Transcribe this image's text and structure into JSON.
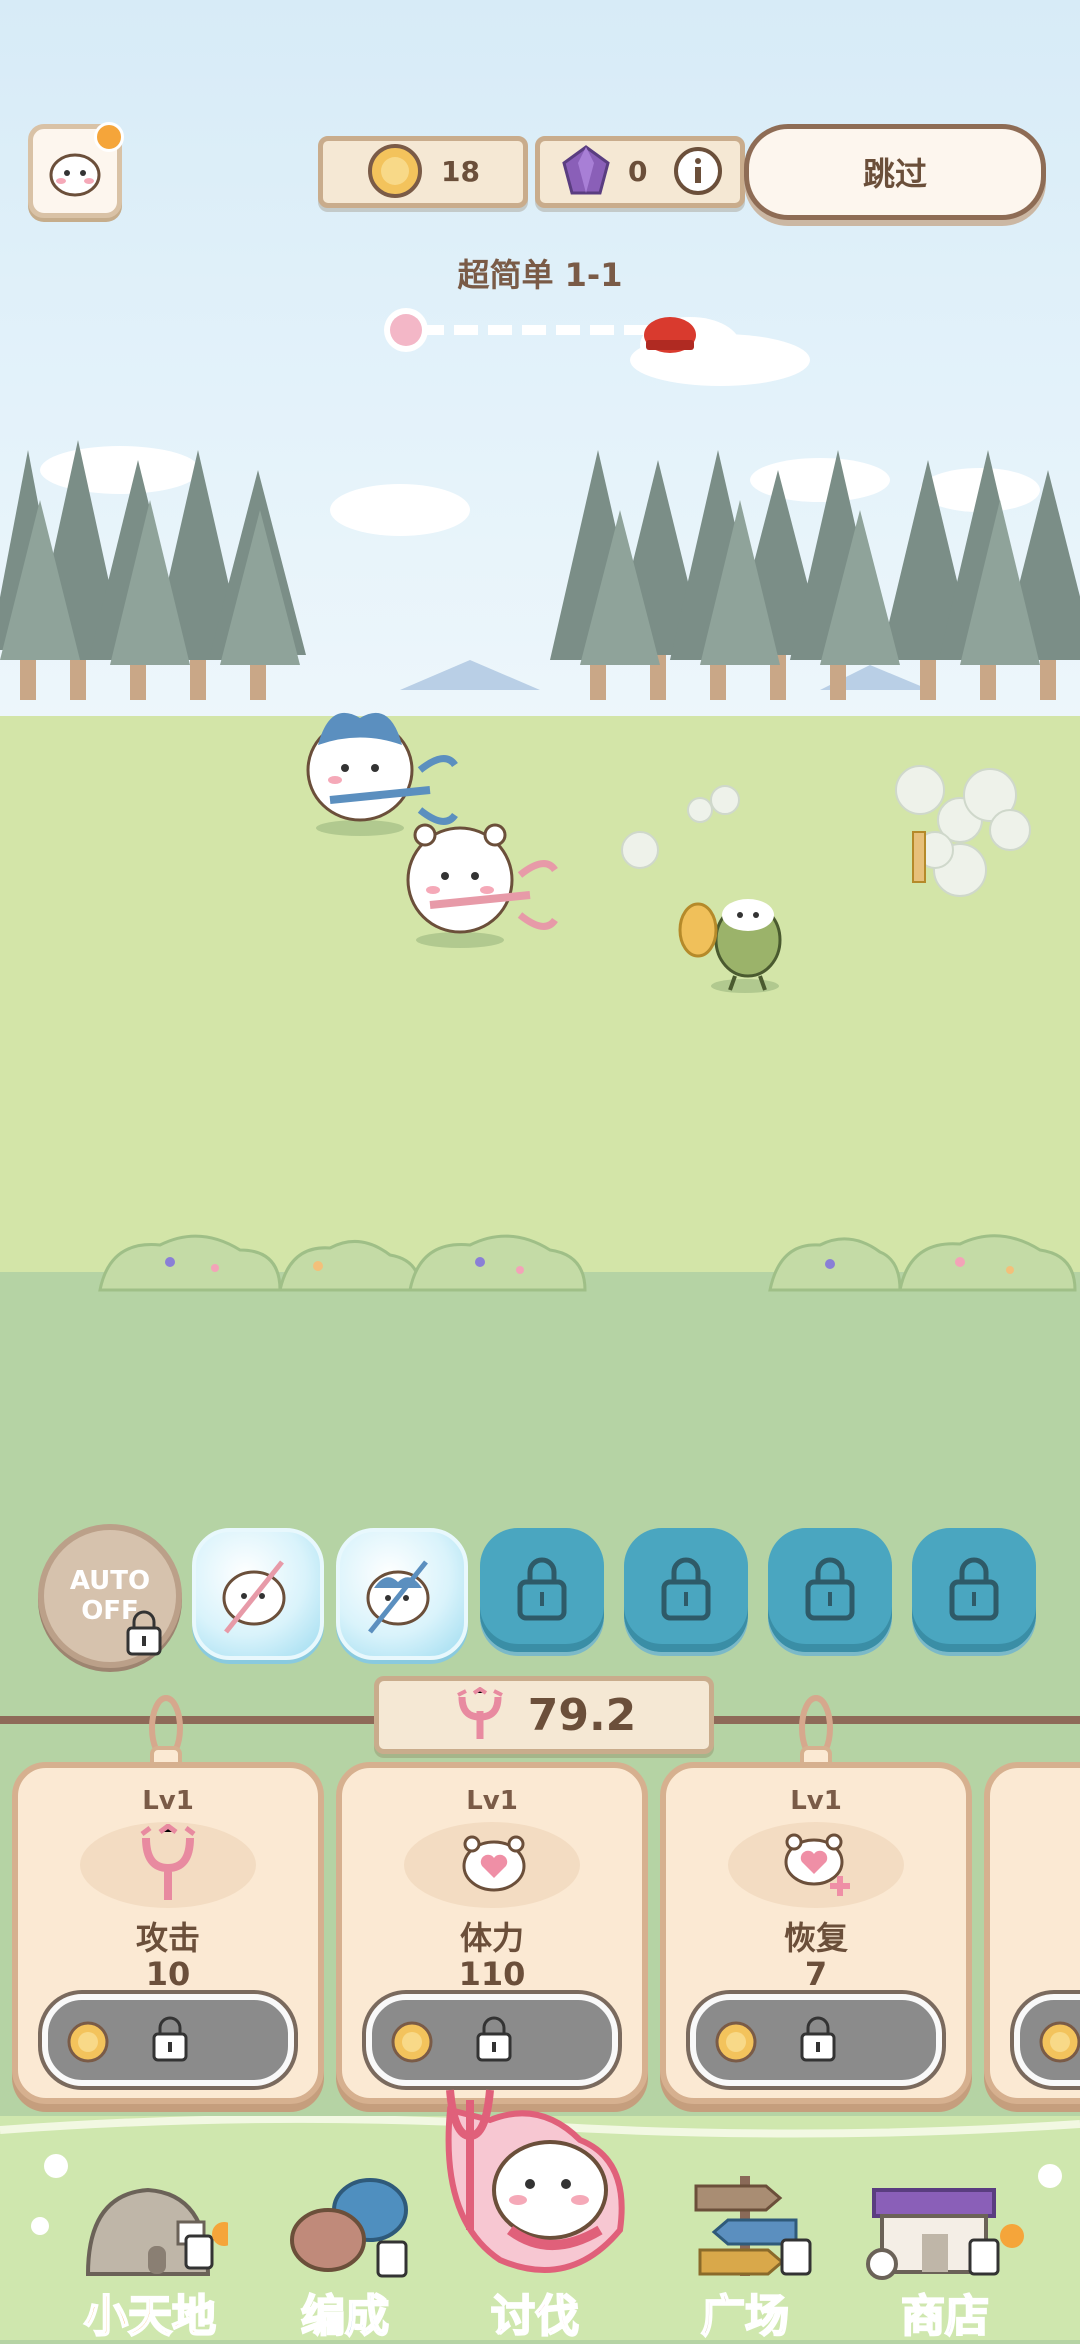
{
  "hud": {
    "coins": "18",
    "gems": "0",
    "skip_label": "跳过",
    "stage_title": "超简单 1-1"
  },
  "skills": {
    "auto_line1": "AUTO",
    "auto_line2": "OFF"
  },
  "power": {
    "value": "79.2"
  },
  "cards": [
    {
      "level": "Lv1",
      "name": "攻击",
      "value": "10"
    },
    {
      "level": "Lv1",
      "name": "体力",
      "value": "110"
    },
    {
      "level": "Lv1",
      "name": "恢复",
      "value": "7"
    }
  ],
  "nav": [
    {
      "label": "小天地",
      "color": "#f0a23c"
    },
    {
      "label": "编成",
      "color": "#4f8fd1"
    },
    {
      "label": "讨伐",
      "color": "#e0607a"
    },
    {
      "label": "广场",
      "color": "#a98d73"
    },
    {
      "label": "商店",
      "color": "#8a5fb8"
    }
  ],
  "icons": [
    "profile-icon",
    "coin-icon",
    "gem-icon",
    "info-icon",
    "lock-icon",
    "attack-icon",
    "hp-icon",
    "recover-icon"
  ]
}
